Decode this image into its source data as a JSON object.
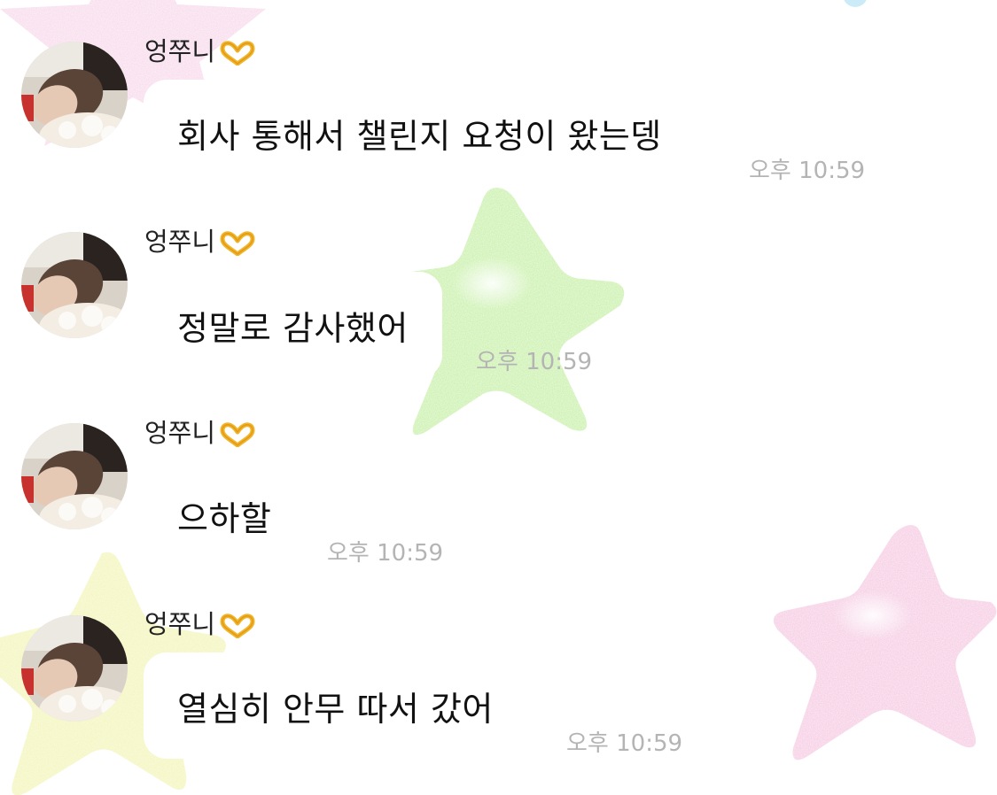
{
  "chat": {
    "messages": [
      {
        "sender": "엉쭈니",
        "sender_emoji": "heart-hands-icon",
        "text": "회사 통해서 챌린지 요청이 왔는뎅",
        "time": "오후 10:59"
      },
      {
        "sender": "엉쭈니",
        "sender_emoji": "heart-hands-icon",
        "text": "정말로 감사했어",
        "time": "오후 10:59"
      },
      {
        "sender": "엉쭈니",
        "sender_emoji": "heart-hands-icon",
        "text": "으하할",
        "time": "오후 10:59"
      },
      {
        "sender": "엉쭈니",
        "sender_emoji": "heart-hands-icon",
        "text": "열심히 안무 따서 갔어",
        "time": "오후 10:59"
      }
    ]
  },
  "colors": {
    "bubble": "#ffffff",
    "time_text": "#b4b4b4",
    "message_text": "#111111",
    "sender_text": "#222222",
    "star_green": "#c5f0a4",
    "star_pink": "#f5c9e3",
    "star_yellow": "#f4f6b0"
  }
}
